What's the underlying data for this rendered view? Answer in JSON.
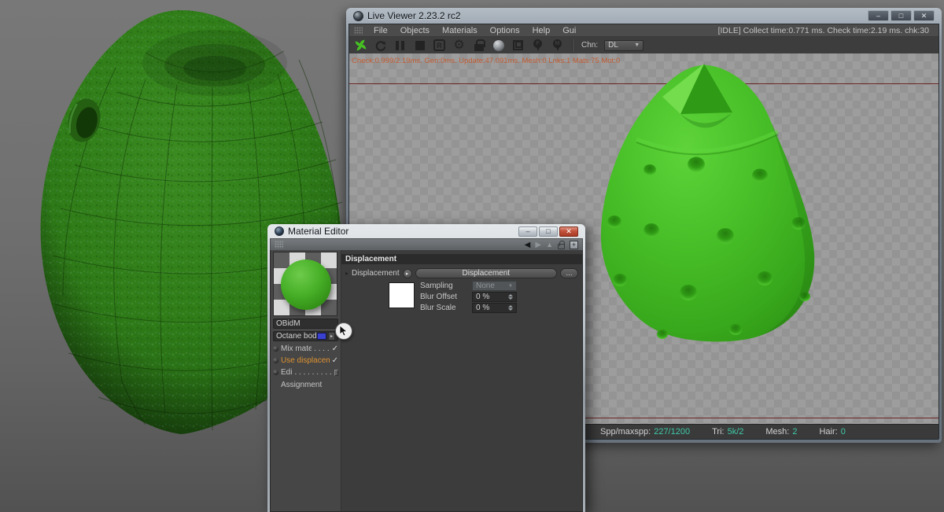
{
  "live_viewer": {
    "title": "Live Viewer 2.23.2 rc2",
    "menus": [
      "File",
      "Objects",
      "Materials",
      "Options",
      "Help",
      "Gui"
    ],
    "status_right": "[IDLE] Collect time:0.771 ms.  Check time:2.19 ms.  chk:30",
    "toolbar": {
      "r_button": "R",
      "pin_f": "F",
      "pin_m": "M",
      "chn_label": "Chn:",
      "channel_value": "DL"
    },
    "overlay_stats": "Check:0.999/2.19ms. Gen:0ms. Update:47.091ms. Mesh:0 Lnks:1 Mats:75 Mot:0",
    "statusbar": [
      {
        "label": "Spp/maxspp:",
        "value": "227/1200"
      },
      {
        "label": "Tri:",
        "value": "5k/2"
      },
      {
        "label": "Mesh:",
        "value": "2"
      },
      {
        "label": "Hair:",
        "value": "0"
      }
    ]
  },
  "material_editor": {
    "title": "Material Editor",
    "name_value": "OBidM",
    "shader_label": "Octane bod",
    "channels": [
      {
        "label": "Mix materials",
        "dots": ". . . .",
        "check": "✓"
      },
      {
        "label": "Use displacement",
        "dots": "",
        "check": "✓"
      },
      {
        "label": "Editor",
        "dots": ". . . . . . . . .",
        "check": ""
      }
    ],
    "assignment_label": "Assignment",
    "displacement": {
      "header": "Displacement",
      "row_label": "Displacement",
      "node_button": "Displacement",
      "more_button": "...",
      "fields": [
        {
          "label": "Sampling",
          "value": "None"
        },
        {
          "label": "Blur Offset",
          "value": "0 %"
        },
        {
          "label": "Blur Scale",
          "value": "0 %"
        }
      ]
    }
  },
  "glyphs": {
    "minimize": "–",
    "maximize": "□",
    "close": "✕",
    "back": "◀",
    "forward": "▶",
    "up": "▲",
    "plus": "+",
    "triangle_right": "▸",
    "dropdown_arrow": "▼",
    "gear": "⚙"
  },
  "colors": {
    "octane_green": "#46c222",
    "value_teal": "#3fc9a7",
    "highlight_orange": "#dd9232",
    "overlay_orange": "#c25c32",
    "shader_swatch_blue": "#3a40cf"
  }
}
